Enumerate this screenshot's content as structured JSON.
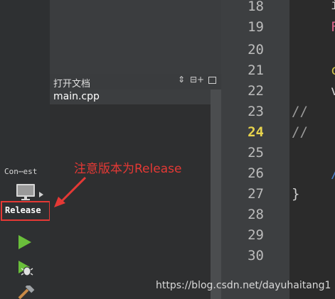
{
  "modebar": {
    "kit_label": "Con⋯est",
    "build_config": "Release"
  },
  "open_docs": {
    "title": "打开文档",
    "sort_glyph": "⇕",
    "split_glyph": "⊟+",
    "files": [
      "main.cpp"
    ]
  },
  "editor": {
    "line_numbers": [
      "18",
      "19",
      "20",
      "21",
      "22",
      "23",
      "24",
      "25",
      "26",
      "27",
      "28",
      "29",
      "30"
    ],
    "current_line": "24",
    "code_fragments": [
      {
        "line": "18",
        "text": "i"
      },
      {
        "line": "19",
        "text": "F"
      },
      {
        "line": "21",
        "text": "c"
      },
      {
        "line": "22",
        "text": "v"
      },
      {
        "line": "23",
        "text": "//"
      },
      {
        "line": "24",
        "text": "//"
      },
      {
        "line": "26",
        "text": "/"
      },
      {
        "line": "27",
        "text": "}"
      }
    ]
  },
  "annotation": {
    "text": "注意版本为Release"
  },
  "watermark": "https://blog.csdn.net/dayuhaitang1",
  "colors": {
    "annotation_red": "#e53935",
    "current_line_number": "#e8d44d",
    "run_green": "#6abf3b"
  },
  "icons": [
    "monitor-icon",
    "run-icon",
    "debug-icon",
    "build-icon",
    "close-icon",
    "split-icon"
  ]
}
